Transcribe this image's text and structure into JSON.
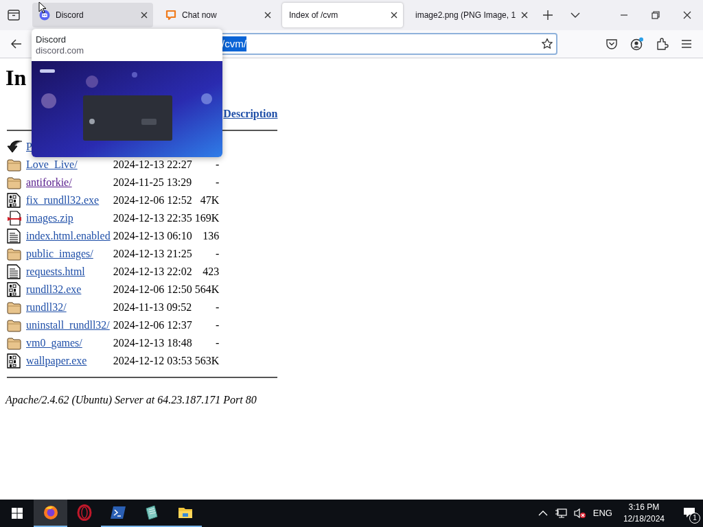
{
  "browser": {
    "tabs": [
      {
        "title": "Discord",
        "selected": false,
        "hovered": true
      },
      {
        "title": "Chat now",
        "selected": false,
        "hovered": false
      },
      {
        "title": "Index of /cvm",
        "selected": true,
        "hovered": false
      },
      {
        "title": "image2.png (PNG Image, 1",
        "selected": false,
        "hovered": false
      }
    ],
    "url": "/cvm/",
    "url_selected": true,
    "tab_preview": {
      "title": "Discord",
      "domain": "discord.com"
    }
  },
  "page": {
    "heading": "In",
    "description_header": "Description",
    "rows": [
      {
        "kind": "back",
        "name": "P",
        "visited": false
      },
      {
        "kind": "folder",
        "name": "Love_Live/",
        "modified": "2024-12-13 22:27",
        "size": "-",
        "visited": false
      },
      {
        "kind": "folder",
        "name": "antiforkie/",
        "modified": "2024-11-25 13:29",
        "size": "-",
        "visited": true
      },
      {
        "kind": "binary",
        "name": "fix_rundll32.exe",
        "modified": "2024-12-06 12:52",
        "size": "47K",
        "visited": false
      },
      {
        "kind": "compressed",
        "name": "images.zip",
        "modified": "2024-12-13 22:35",
        "size": "169K",
        "visited": false
      },
      {
        "kind": "text",
        "name": "index.html.enabled",
        "modified": "2024-12-13 06:10",
        "size": "136",
        "visited": false
      },
      {
        "kind": "folder",
        "name": "public_images/",
        "modified": "2024-12-13 21:25",
        "size": "-",
        "visited": false
      },
      {
        "kind": "text",
        "name": "requests.html",
        "modified": "2024-12-13 22:02",
        "size": "423",
        "visited": false
      },
      {
        "kind": "binary",
        "name": "rundll32.exe",
        "modified": "2024-12-06 12:50",
        "size": "564K",
        "visited": false
      },
      {
        "kind": "folder",
        "name": "rundll32/",
        "modified": "2024-11-13 09:52",
        "size": "-",
        "visited": false
      },
      {
        "kind": "folder",
        "name": "uninstall_rundll32/",
        "modified": "2024-12-06 12:37",
        "size": "-",
        "visited": false
      },
      {
        "kind": "folder",
        "name": "vm0_games/",
        "modified": "2024-12-13 18:48",
        "size": "-",
        "visited": false
      },
      {
        "kind": "binary",
        "name": "wallpaper.exe",
        "modified": "2024-12-12 03:53",
        "size": "563K",
        "visited": false
      }
    ],
    "address": "Apache/2.4.62 (Ubuntu) Server at 64.23.187.171 Port 80"
  },
  "taskbar": {
    "apps": [
      {
        "running": true,
        "active": true
      },
      {
        "running": false,
        "active": false
      },
      {
        "running": true,
        "active": false
      },
      {
        "running": true,
        "active": false
      },
      {
        "running": true,
        "active": false
      }
    ],
    "language": "ENG",
    "time": "3:16 PM",
    "date": "12/18/2024",
    "notifications": "1"
  }
}
